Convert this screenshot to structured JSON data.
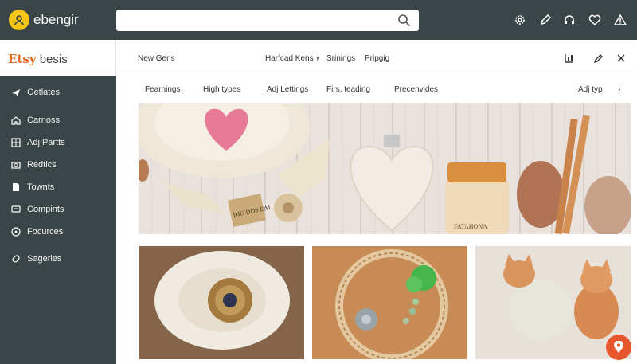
{
  "app": {
    "logo_text": "ebengir"
  },
  "search": {
    "placeholder": ""
  },
  "sidebar": {
    "brand_accent": "Etsy",
    "brand_rest": "besis",
    "items": [
      {
        "label": "Getlates",
        "icon": "plane-icon"
      },
      {
        "label": "Carnoss",
        "icon": "home-icon"
      },
      {
        "label": "Adj Partts",
        "icon": "grid-icon"
      },
      {
        "label": "Redtics",
        "icon": "camera-icon"
      },
      {
        "label": "Townts",
        "icon": "document-icon"
      },
      {
        "label": "Compints",
        "icon": "message-icon"
      },
      {
        "label": "Focurces",
        "icon": "target-icon"
      },
      {
        "label": "Sageries",
        "icon": "link-icon"
      }
    ]
  },
  "header": {
    "row1": {
      "new_gens": "New Gens",
      "dropdown": "Harfcad Kens",
      "srinings": "Srinings",
      "pripgig": "Pripgig"
    },
    "row2": {
      "tabs": [
        "Fearnings",
        "High types",
        "Adj Lettings",
        "Firs, teading",
        "Precenvides"
      ],
      "right_label": "Adj typ"
    }
  },
  "images": {
    "hero_jar_label": "FATAHONA",
    "hero_tag_text": "DIG DDS EAL"
  },
  "colors": {
    "topbar": "#3a4548",
    "sidebar": "#3a4548",
    "logo_yellow": "#f5c518",
    "brand_orange": "#e36a1c",
    "pin_button": "#e8572c"
  }
}
